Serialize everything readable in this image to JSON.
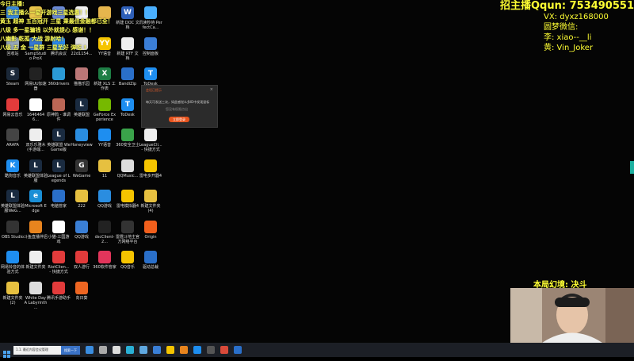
{
  "chat": [
    "今日主播:",
    "三 我主播么一星开游戏三星选惠！！",
    "黄玉 超神 五百冠开 三星 乘最佳金融都已全！",
    "八级 多一星骗钱 以外就提心 感谢！！",
    "八幽影 乾孤 大战 游射哈！",
    "八级 五 金 一星群 三星至好 弹吃 !"
  ],
  "info": {
    "qq_label": "招主播Qqun:",
    "qq_number": "753490551",
    "vx": "VX: dyxz168000",
    "wechat_title": "圆梦微信:",
    "li": "李: xiao--__li",
    "huang": "黄: Vin_Joker"
  },
  "caption": "本局幻境: 决斗",
  "dialog": {
    "title": "会话已提示",
    "close": "×",
    "message": "每天可发送三次，如此感觉么多ID中发现鼠标",
    "sub": "您没有权限点出",
    "button": "立即登录"
  },
  "taskbar": {
    "search_placeholder": "1.1. 最近内容会议管理",
    "search_button": "搜索一下"
  },
  "icons": [
    {
      "label": "",
      "color": "#3a8de0",
      "glyph": ""
    },
    {
      "label": "",
      "color": "#e9c54a",
      "glyph": ""
    },
    {
      "label": "",
      "color": "#6b8bd6",
      "glyph": ""
    },
    {
      "label": "",
      "color": "#f2f2f2",
      "glyph": ""
    },
    {
      "label": "",
      "color": "#e6b64d",
      "glyph": ""
    },
    {
      "label": "新建 DOC 文档",
      "color": "#2e5fb7",
      "glyph": "W"
    },
    {
      "label": "讯读秒待 PerfectCa...",
      "color": "#4ab0ff",
      "glyph": ""
    },
    {
      "label": "回收站",
      "color": "#9ab",
      "glyph": ""
    },
    {
      "label": "SampStudio ProX",
      "color": "#3579d6",
      "glyph": ""
    },
    {
      "label": "腾讯会议",
      "color": "#2b8cf0",
      "glyph": ""
    },
    {
      "label": "22d1154...",
      "color": "#ddd",
      "glyph": ""
    },
    {
      "label": "YY语音",
      "color": "#f5c400",
      "glyph": "YY"
    },
    {
      "label": "新建 RTF 文档",
      "color": "#eee",
      "glyph": ""
    },
    {
      "label": "控制面板",
      "color": "#3b7ed6",
      "glyph": ""
    },
    {
      "label": "Steam",
      "color": "#1b2838",
      "glyph": "S"
    },
    {
      "label": "网易UU加速器",
      "color": "#222",
      "glyph": ""
    },
    {
      "label": "360drivers",
      "color": "#2b9ad6",
      "glyph": ""
    },
    {
      "label": "猫猫乐园",
      "color": "#b77",
      "glyph": ""
    },
    {
      "label": "新建 XLS 工作表",
      "color": "#1e7e45",
      "glyph": "X"
    },
    {
      "label": "BandiZip",
      "color": "#2a6fc9",
      "glyph": ""
    },
    {
      "label": "ToDesk",
      "color": "#1e8ef0",
      "glyph": "T"
    },
    {
      "label": "网易云音乐",
      "color": "#e23b3b",
      "glyph": ""
    },
    {
      "label": "16464646...",
      "color": "#fff",
      "glyph": ""
    },
    {
      "label": "原神鸦 - 谁调件",
      "color": "#b65",
      "glyph": ""
    },
    {
      "label": "英雄联盟",
      "color": "#1a2b40",
      "glyph": "L"
    },
    {
      "label": "GeForce Experience",
      "color": "#76b900",
      "glyph": ""
    },
    {
      "label": "ToDesk",
      "color": "#1e8ef0",
      "glyph": "T"
    },
    {
      "label": "微信",
      "color": "#2dc100",
      "glyph": ""
    },
    {
      "label": "ARAFA",
      "color": "#444",
      "glyph": ""
    },
    {
      "label": "双乐乐雅木(手游端...",
      "color": "#eee",
      "glyph": ""
    },
    {
      "label": "英雄联盟 WeGame版",
      "color": "#1a2b40",
      "glyph": "L"
    },
    {
      "label": "Honeyview",
      "color": "#2a8de0",
      "glyph": ""
    },
    {
      "label": "YY语音",
      "color": "#1e8ef0",
      "glyph": ""
    },
    {
      "label": "360安全卫士",
      "color": "#3aa34a",
      "glyph": ""
    },
    {
      "label": "LeagueCli... - 快捷方式",
      "color": "#eee",
      "glyph": ""
    },
    {
      "label": "酷狗音乐",
      "color": "#1e8ef0",
      "glyph": "K"
    },
    {
      "label": "英雄联盟体验服",
      "color": "#1a2b40",
      "glyph": "L"
    },
    {
      "label": "League of Legends",
      "color": "#1a2b40",
      "glyph": "L"
    },
    {
      "label": "WeGame",
      "color": "#333",
      "glyph": "G"
    },
    {
      "label": "11",
      "color": "#e6c040",
      "glyph": ""
    },
    {
      "label": "QQMusic...",
      "color": "#ddd",
      "glyph": ""
    },
    {
      "label": "雷电多开器4",
      "color": "#f5c400",
      "glyph": ""
    },
    {
      "label": "英雄联盟体验服WeG...",
      "color": "#1a2b40",
      "glyph": "L"
    },
    {
      "label": "Microsoft Edge",
      "color": "#1a8fd6",
      "glyph": "e"
    },
    {
      "label": "电脑管家",
      "color": "#2a6fc9",
      "glyph": ""
    },
    {
      "label": "222",
      "color": "#e6c040",
      "glyph": ""
    },
    {
      "label": "QQ游戏",
      "color": "#2a8de0",
      "glyph": ""
    },
    {
      "label": "雷电模拟器4",
      "color": "#f5c400",
      "glyph": ""
    },
    {
      "label": "新建文件夹(4)",
      "color": "#e6c040",
      "glyph": ""
    },
    {
      "label": "OBS Studio",
      "color": "#333",
      "glyph": ""
    },
    {
      "label": "斗鱼直播伴侣",
      "color": "#e8841e",
      "glyph": ""
    },
    {
      "label": "小猫-三国游戏",
      "color": "#fff",
      "glyph": ""
    },
    {
      "label": "QQ游戏",
      "color": "#3a7fd6",
      "glyph": ""
    },
    {
      "label": "dscClient-2...",
      "color": "#222",
      "glyph": ""
    },
    {
      "label": "雷霆斗地主官方网络平台",
      "color": "#333",
      "glyph": ""
    },
    {
      "label": "Origin",
      "color": "#f25f1c",
      "glyph": ""
    },
    {
      "label": "网易铃音的体验方式",
      "color": "#1e8ef0",
      "glyph": ""
    },
    {
      "label": "新建文件夹",
      "color": "#eee",
      "glyph": ""
    },
    {
      "label": "RiotClien... - 快捷方式",
      "color": "#e23b3b",
      "glyph": ""
    },
    {
      "label": "双人游行",
      "color": "#e23b3b",
      "glyph": ""
    },
    {
      "label": "360软件管家",
      "color": "#e2355b",
      "glyph": ""
    },
    {
      "label": "QQ音乐",
      "color": "#f5c400",
      "glyph": ""
    },
    {
      "label": "驱动总裁",
      "color": "#2a6fc9",
      "glyph": ""
    },
    {
      "label": "新建文件夹(2)",
      "color": "#e6c040",
      "glyph": ""
    },
    {
      "label": "White Day A Labyrinth ...",
      "color": "#ddd",
      "glyph": ""
    },
    {
      "label": "腾讯手游助手",
      "color": "#e23b3b",
      "glyph": ""
    },
    {
      "label": "向日葵",
      "color": "#ee6622",
      "glyph": ""
    }
  ]
}
